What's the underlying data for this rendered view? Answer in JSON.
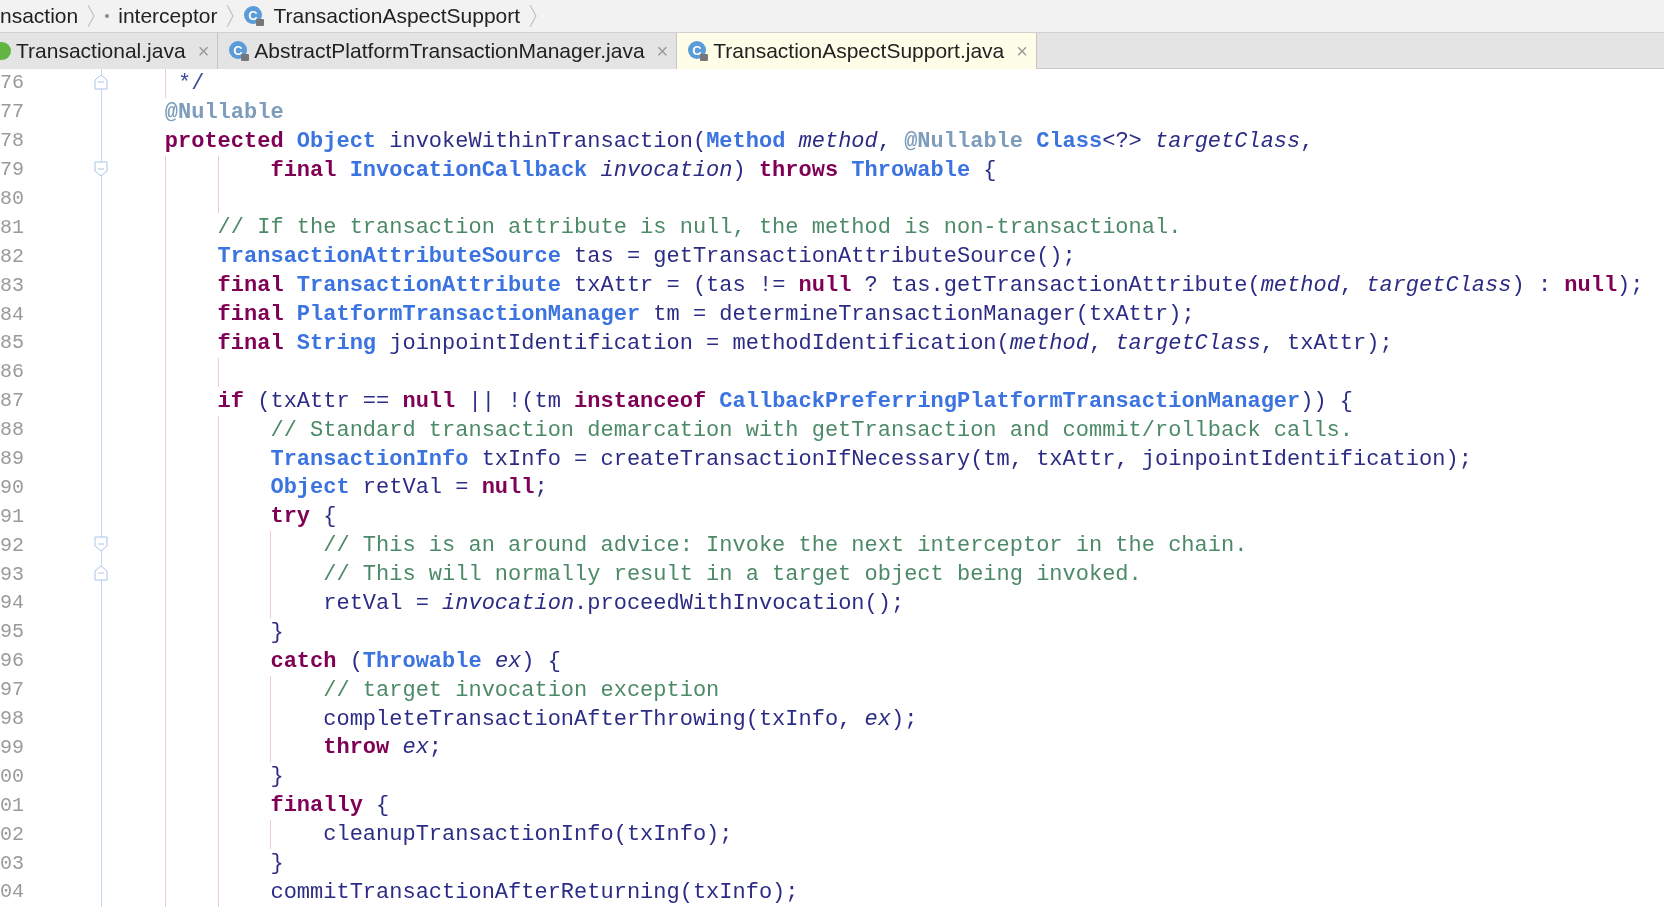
{
  "breadcrumb": [
    {
      "label": "nsaction"
    },
    {
      "label": "interceptor",
      "kind": "package"
    },
    {
      "label": "TransactionAspectSupport",
      "kind": "class",
      "icon_letter": "C"
    }
  ],
  "tabs": [
    {
      "label": "Transactional.java",
      "kind": "annotation",
      "close": "×",
      "selected": false
    },
    {
      "label": "AbstractPlatformTransactionManager.java",
      "kind": "class",
      "icon_letter": "C",
      "close": "×",
      "selected": false
    },
    {
      "label": "TransactionAspectSupport.java",
      "kind": "class",
      "icon_letter": "C",
      "close": "×",
      "selected": true
    }
  ],
  "lines": [
    {
      "number": "76",
      "kind": "fold-end",
      "tokens": [
        {
          "text": "     */",
          "kind": "doc"
        }
      ]
    },
    {
      "number": "77",
      "tokens": [
        {
          "text": "    @Nullable",
          "kind": "ann"
        }
      ]
    },
    {
      "number": "78",
      "tokens": [
        {
          "text": "    protected ",
          "kind": "kw"
        },
        {
          "text": "Object",
          "kind": "type"
        },
        {
          "text": " invokeWithinTransaction(",
          "kind": "txt"
        },
        {
          "text": "Method ",
          "kind": "type"
        },
        {
          "text": "method",
          "kind": "param"
        },
        {
          "text": ", ",
          "kind": "txt"
        },
        {
          "text": "@Nullable ",
          "kind": "ann"
        },
        {
          "text": "Class",
          "kind": "type"
        },
        {
          "text": "<?> ",
          "kind": "txt"
        },
        {
          "text": "targetClass",
          "kind": "param"
        },
        {
          "text": ",",
          "kind": "txt"
        }
      ]
    },
    {
      "number": "79",
      "kind": "fold-start",
      "tokens": [
        {
          "text": "            final ",
          "kind": "kw"
        },
        {
          "text": "InvocationCallback ",
          "kind": "type"
        },
        {
          "text": "invocation",
          "kind": "param"
        },
        {
          "text": ") ",
          "kind": "txt"
        },
        {
          "text": "throws ",
          "kind": "kw"
        },
        {
          "text": "Throwable",
          "kind": "type"
        },
        {
          "text": " {",
          "kind": "txt"
        }
      ]
    },
    {
      "number": "80"
    },
    {
      "number": "81",
      "tokens": [
        {
          "text": "        // If the transaction attribute is null, the method is non-transactional.",
          "kind": "cmt"
        }
      ]
    },
    {
      "number": "82",
      "tokens": [
        {
          "text": "        TransactionAttributeSource",
          "kind": "type"
        },
        {
          "text": " tas = getTransactionAttributeSource();",
          "kind": "txt"
        }
      ]
    },
    {
      "number": "83",
      "tokens": [
        {
          "text": "        final ",
          "kind": "kw"
        },
        {
          "text": "TransactionAttribute",
          "kind": "type"
        },
        {
          "text": " txAttr = (tas != ",
          "kind": "txt"
        },
        {
          "text": "null",
          "kind": "kw"
        },
        {
          "text": " ? tas.getTransactionAttribute(",
          "kind": "txt"
        },
        {
          "text": "method",
          "kind": "param"
        },
        {
          "text": ", ",
          "kind": "txt"
        },
        {
          "text": "targetClass",
          "kind": "param"
        },
        {
          "text": ") : ",
          "kind": "txt"
        },
        {
          "text": "null",
          "kind": "kw"
        },
        {
          "text": ");",
          "kind": "txt"
        }
      ]
    },
    {
      "number": "84",
      "tokens": [
        {
          "text": "        final ",
          "kind": "kw"
        },
        {
          "text": "PlatformTransactionManager",
          "kind": "type"
        },
        {
          "text": " tm = determineTransactionManager(txAttr);",
          "kind": "txt"
        }
      ]
    },
    {
      "number": "85",
      "tokens": [
        {
          "text": "        final ",
          "kind": "kw"
        },
        {
          "text": "String",
          "kind": "type"
        },
        {
          "text": " joinpointIdentification = methodIdentification(",
          "kind": "txt"
        },
        {
          "text": "method",
          "kind": "param"
        },
        {
          "text": ", ",
          "kind": "txt"
        },
        {
          "text": "targetClass",
          "kind": "param"
        },
        {
          "text": ", txAttr);",
          "kind": "txt"
        }
      ]
    },
    {
      "number": "86"
    },
    {
      "number": "87",
      "tokens": [
        {
          "text": "        if",
          "kind": "kw"
        },
        {
          "text": " (txAttr == ",
          "kind": "txt"
        },
        {
          "text": "null",
          "kind": "kw"
        },
        {
          "text": " || !(tm ",
          "kind": "txt"
        },
        {
          "text": "instanceof ",
          "kind": "kw"
        },
        {
          "text": "CallbackPreferringPlatformTransactionManager",
          "kind": "type"
        },
        {
          "text": ")) {",
          "kind": "txt"
        }
      ]
    },
    {
      "number": "88",
      "tokens": [
        {
          "text": "            // Standard transaction demarcation with getTransaction and commit/rollback calls.",
          "kind": "cmt"
        }
      ]
    },
    {
      "number": "89",
      "tokens": [
        {
          "text": "            TransactionInfo",
          "kind": "type"
        },
        {
          "text": " txInfo = createTransactionIfNecessary(tm, txAttr, joinpointIdentification);",
          "kind": "txt"
        }
      ]
    },
    {
      "number": "90",
      "tokens": [
        {
          "text": "            Object",
          "kind": "type"
        },
        {
          "text": " retVal = ",
          "kind": "txt"
        },
        {
          "text": "null",
          "kind": "kw"
        },
        {
          "text": ";",
          "kind": "txt"
        }
      ]
    },
    {
      "number": "91",
      "tokens": [
        {
          "text": "            try",
          "kind": "kw"
        },
        {
          "text": " {",
          "kind": "txt"
        }
      ]
    },
    {
      "number": "92",
      "kind": "fold-start",
      "tokens": [
        {
          "text": "                // This is an around advice: Invoke the next interceptor in the chain.",
          "kind": "cmt"
        }
      ]
    },
    {
      "number": "93",
      "kind": "fold-end",
      "tokens": [
        {
          "text": "                // This will normally result in a target object being invoked.",
          "kind": "cmt"
        }
      ]
    },
    {
      "number": "94",
      "tokens": [
        {
          "text": "                retVal = ",
          "kind": "txt"
        },
        {
          "text": "invocation",
          "kind": "param"
        },
        {
          "text": ".proceedWithInvocation();",
          "kind": "txt"
        }
      ]
    },
    {
      "number": "95",
      "tokens": [
        {
          "text": "            }",
          "kind": "txt"
        }
      ]
    },
    {
      "number": "96",
      "tokens": [
        {
          "text": "            catch",
          "kind": "kw"
        },
        {
          "text": " (",
          "kind": "txt"
        },
        {
          "text": "Throwable ",
          "kind": "type"
        },
        {
          "text": "ex",
          "kind": "param"
        },
        {
          "text": ") {",
          "kind": "txt"
        }
      ]
    },
    {
      "number": "97",
      "tokens": [
        {
          "text": "                // target invocation exception",
          "kind": "cmt"
        }
      ]
    },
    {
      "number": "98",
      "tokens": [
        {
          "text": "                completeTransactionAfterThrowing(txInfo, ",
          "kind": "txt"
        },
        {
          "text": "ex",
          "kind": "param"
        },
        {
          "text": ");",
          "kind": "txt"
        }
      ]
    },
    {
      "number": "99",
      "tokens": [
        {
          "text": "                throw ",
          "kind": "kw"
        },
        {
          "text": "ex",
          "kind": "param"
        },
        {
          "text": ";",
          "kind": "txt"
        }
      ]
    },
    {
      "number": "00",
      "tokens": [
        {
          "text": "            }",
          "kind": "txt"
        }
      ]
    },
    {
      "number": "01",
      "tokens": [
        {
          "text": "            finally",
          "kind": "kw"
        },
        {
          "text": " {",
          "kind": "txt"
        }
      ]
    },
    {
      "number": "02",
      "tokens": [
        {
          "text": "                cleanupTransactionInfo(txInfo);",
          "kind": "txt"
        }
      ]
    },
    {
      "number": "03",
      "tokens": [
        {
          "text": "            }",
          "kind": "txt"
        }
      ]
    },
    {
      "number": "04",
      "tokens": [
        {
          "text": "            commitTransactionAfterReturning(txInfo);",
          "kind": "txt"
        }
      ]
    }
  ]
}
